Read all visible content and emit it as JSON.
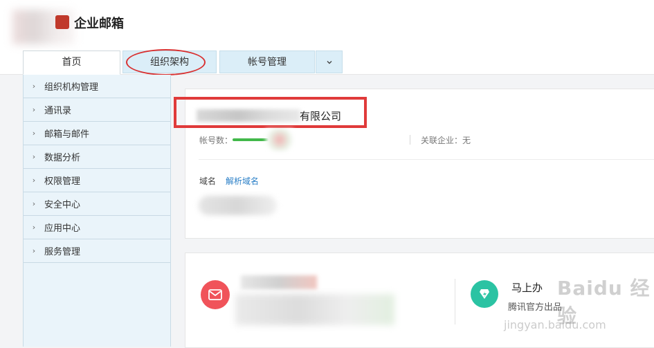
{
  "header": {
    "app_title": "企业邮箱",
    "tabs": [
      {
        "label": "首页"
      },
      {
        "label": "组织架构"
      },
      {
        "label": "帐号管理"
      }
    ],
    "more_icon": "chevron-down-icon"
  },
  "sidebar": {
    "items": [
      {
        "label": "组织机构管理"
      },
      {
        "label": "通讯录"
      },
      {
        "label": "邮箱与邮件"
      },
      {
        "label": "数据分析"
      },
      {
        "label": "权限管理"
      },
      {
        "label": "安全中心"
      },
      {
        "label": "应用中心"
      },
      {
        "label": "服务管理"
      }
    ]
  },
  "company": {
    "name_suffix": "有限公司",
    "accounts_label": "帐号数：",
    "related_label": "关联企业：无",
    "domain_label": "域名",
    "resolve_domain_link": "解析域名"
  },
  "apps": {
    "mashang_title": "马上办",
    "mashang_subtitle": "腾讯官方出品"
  },
  "watermark": {
    "text": "Baidu 经验",
    "url": "jingyan.baidu.com"
  },
  "colors": {
    "accent_red": "#e03a3a",
    "tab_bg": "#dbeef8",
    "sidebar_bg": "#eaf4fa",
    "link_blue": "#2a7fc7",
    "progress_green": "#42b84a",
    "mail_icon_bg": "#f0535a",
    "mashang_icon_bg": "#2bc3a3"
  }
}
